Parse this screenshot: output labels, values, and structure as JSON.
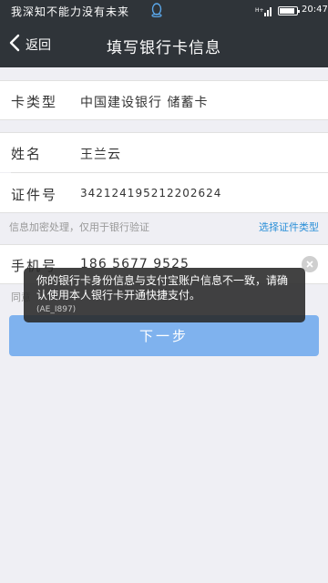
{
  "status_bar": {
    "carrier_text": "我深知不能力没有未来",
    "time": "20:47",
    "battery_level": 0.9
  },
  "nav": {
    "back_label": "返回",
    "title": "填写银行卡信息"
  },
  "form": {
    "card_type": {
      "label": "卡类型",
      "value": "中国建设银行 储蓄卡"
    },
    "name": {
      "label": "姓名",
      "value": "王兰云"
    },
    "id_number": {
      "label": "证件号",
      "value": "342124195212202624"
    },
    "hint": "信息加密处理，仅用于银行验证",
    "select_id_type": "选择证件类型",
    "phone": {
      "label": "手机号",
      "value": "186 5677 9525"
    },
    "agreement_prefix": "同意"
  },
  "next_button": "下一步",
  "toast": {
    "message": "你的银行卡身份信息与支付宝账户信息不一致，请确认使用本人银行卡开通快捷支付。",
    "code": "(AE_I897)"
  }
}
